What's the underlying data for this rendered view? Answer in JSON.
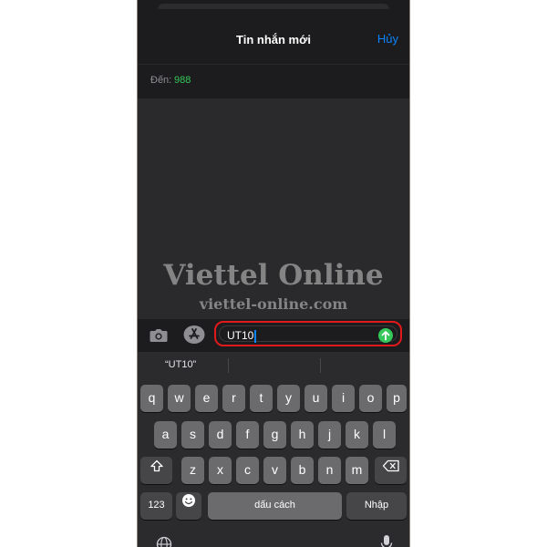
{
  "nav": {
    "title": "Tin nhắn mới",
    "cancel_label": "Hủy"
  },
  "to": {
    "label": "Đến:",
    "value": "988"
  },
  "watermark": {
    "line1": "Viettel Online",
    "line2": "viettel-online.com"
  },
  "compose": {
    "input_value": "UT10"
  },
  "keyboard": {
    "suggestion_1": "“UT10”",
    "row1": [
      "q",
      "w",
      "e",
      "r",
      "t",
      "y",
      "u",
      "i",
      "o",
      "p"
    ],
    "row2": [
      "a",
      "s",
      "d",
      "f",
      "g",
      "h",
      "j",
      "k",
      "l"
    ],
    "row3": [
      "z",
      "x",
      "c",
      "v",
      "b",
      "n",
      "m"
    ],
    "numbers_label": "123",
    "space_label": "dấu cách",
    "return_label": "Nhập"
  },
  "colors": {
    "accent": "#0a84ff",
    "recipient": "#34c759",
    "highlight": "#e0191b",
    "send": "#34c759"
  },
  "icons": [
    "camera-icon",
    "app-store-icon",
    "send-arrow-icon",
    "shift-icon",
    "backspace-icon",
    "emoji-icon",
    "globe-icon",
    "microphone-icon"
  ]
}
